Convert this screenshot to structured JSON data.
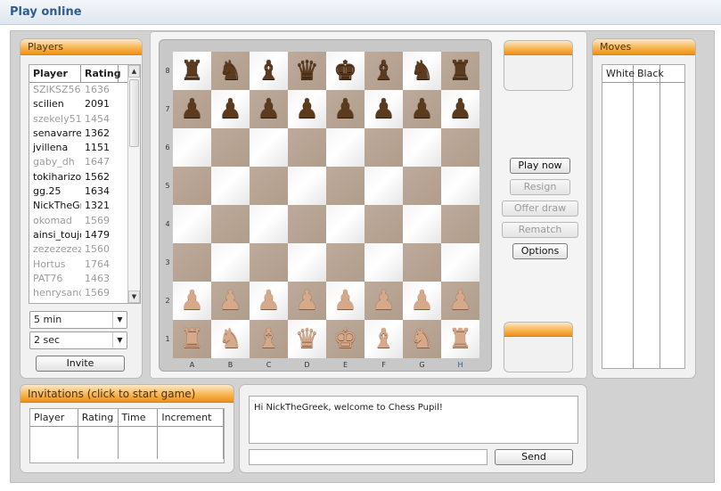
{
  "page": {
    "title": "Play online"
  },
  "players": {
    "title": "Players",
    "columns": [
      "Player",
      "Rating"
    ],
    "rows": [
      {
        "name": "SZIKSZ56",
        "rating": "1636",
        "status": "dim"
      },
      {
        "name": "scilien",
        "rating": "2091",
        "status": "on"
      },
      {
        "name": "szekely51",
        "rating": "1454",
        "status": "dim"
      },
      {
        "name": "senavarre",
        "rating": "1362",
        "status": "on"
      },
      {
        "name": "jvillena",
        "rating": "1151",
        "status": "on"
      },
      {
        "name": "gaby_dh",
        "rating": "1647",
        "status": "dim"
      },
      {
        "name": "tokiharizo",
        "rating": "1562",
        "status": "on"
      },
      {
        "name": "gg.25",
        "rating": "1634",
        "status": "on"
      },
      {
        "name": "NickTheGre",
        "rating": "1321",
        "status": "on"
      },
      {
        "name": "okomad",
        "rating": "1569",
        "status": "dim"
      },
      {
        "name": "ainsi_toujo",
        "rating": "1479",
        "status": "on"
      },
      {
        "name": "zezezezeze",
        "rating": "1560",
        "status": "dim"
      },
      {
        "name": "Hortus",
        "rating": "1764",
        "status": "dim"
      },
      {
        "name": "PAT76",
        "rating": "1463",
        "status": "dim"
      },
      {
        "name": "henrysand",
        "rating": "1569",
        "status": "dim"
      }
    ],
    "time_select": "5 min",
    "increment_select": "2 sec",
    "invite_label": "Invite"
  },
  "board": {
    "ranks": [
      "8",
      "7",
      "6",
      "5",
      "4",
      "3",
      "2",
      "1"
    ],
    "files": [
      "A",
      "B",
      "C",
      "D",
      "E",
      "F",
      "G",
      "H"
    ],
    "highlighted_file": "H",
    "position": [
      [
        "br",
        "bn",
        "bb",
        "bq",
        "bk",
        "bb",
        "bn",
        "br"
      ],
      [
        "bp",
        "bp",
        "bp",
        "bp",
        "bp",
        "bp",
        "bp",
        "bp"
      ],
      [
        "",
        "",
        "",
        "",
        "",
        "",
        "",
        ""
      ],
      [
        "",
        "",
        "",
        "",
        "",
        "",
        "",
        ""
      ],
      [
        "",
        "",
        "",
        "",
        "",
        "",
        "",
        ""
      ],
      [
        "",
        "",
        "",
        "",
        "",
        "",
        "",
        ""
      ],
      [
        "wp",
        "wp",
        "wp",
        "wp",
        "wp",
        "wp",
        "wp",
        "wp"
      ],
      [
        "wr",
        "wn",
        "wb",
        "wq",
        "wk",
        "wb",
        "wn",
        "wr"
      ]
    ]
  },
  "controls": {
    "play_now": "Play now",
    "resign": "Resign",
    "offer_draw": "Offer draw",
    "rematch": "Rematch",
    "options": "Options"
  },
  "moves": {
    "title": "Moves",
    "columns": [
      "White",
      "Black"
    ]
  },
  "invitations": {
    "title": "Invitations (click to start game)",
    "columns": [
      "Player",
      "Rating",
      "Time",
      "Increment"
    ]
  },
  "chat": {
    "message": "Hi NickTheGreek, welcome to Chess Pupil!",
    "input_value": "",
    "send_label": "Send"
  },
  "colors": {
    "accent_orange": "#f08f17",
    "title_blue": "#2d5d93",
    "dark_square": "#b09d8c",
    "light_square": "#ffffff"
  }
}
